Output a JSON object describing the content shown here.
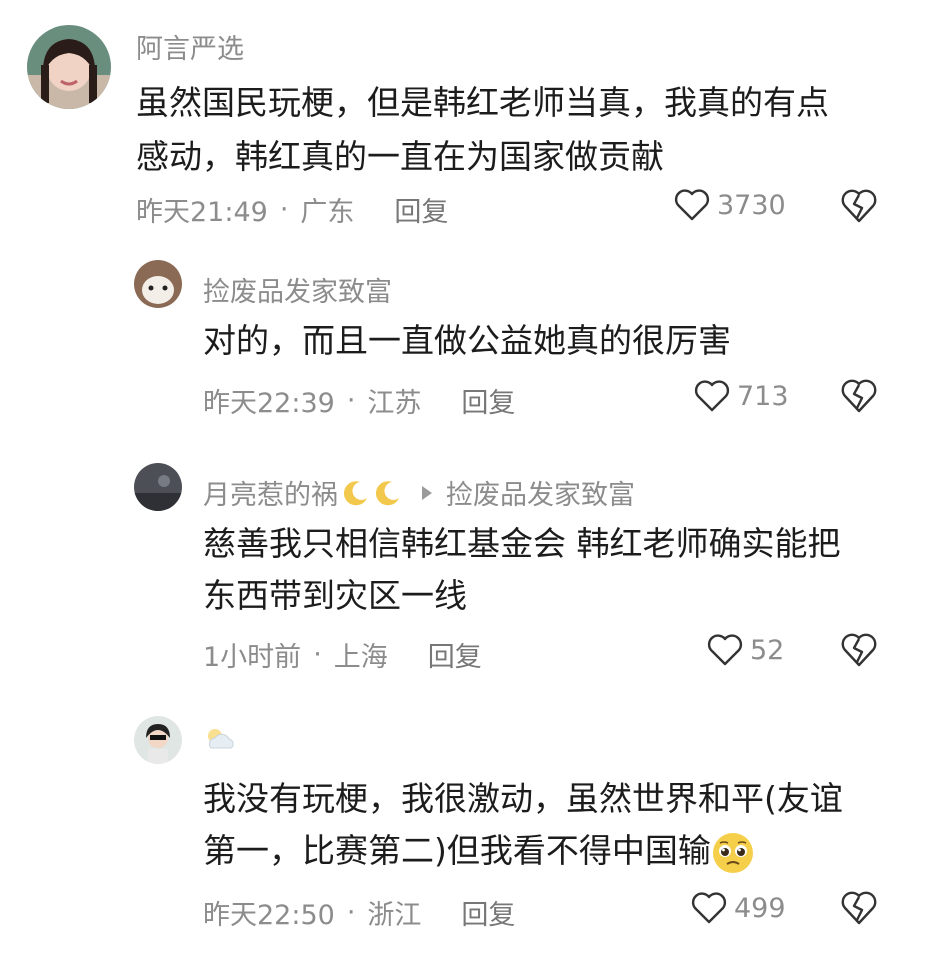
{
  "comments": [
    {
      "username": "阿言严选",
      "lines": [
        "虽然国民玩梗，但是韩红老师当真，我真的有点",
        "感动，韩红真的一直在为国家做贡献"
      ],
      "time": "昨天21:49",
      "location": "广东",
      "reply_label": "回复",
      "likes": "3730"
    },
    {
      "username": "捡废品发家致富",
      "lines": [
        "对的，而且一直做公益她真的很厉害"
      ],
      "time": "昨天22:39",
      "location": "江苏",
      "reply_label": "回复",
      "likes": "713"
    },
    {
      "username": "月亮惹的祸",
      "reply_to": "捡废品发家致富",
      "lines": [
        "慈善我只相信韩红基金会 韩红老师确实能把",
        "东西带到灾区一线"
      ],
      "time": "1小时前",
      "location": "上海",
      "reply_label": "回复",
      "likes": "52"
    },
    {
      "username": "",
      "lines": [
        "我没有玩梗，我很激动，虽然世界和平(友谊",
        "第一，比赛第二)但我看不得中国输"
      ],
      "time": "昨天22:50",
      "location": "浙江",
      "reply_label": "回复",
      "likes": "499"
    }
  ],
  "icons": {
    "like": "heart-outline-icon",
    "dislike": "broken-heart-icon",
    "cloud": "sun-behind-cloud-icon",
    "moon": "crescent-moon-icon",
    "emoji": "pleading-face-icon",
    "reply_arrow": "play-triangle-icon"
  },
  "colors": {
    "meta_text": "#8c8c8c",
    "body_text": "#1c1c1c",
    "background": "#ffffff"
  }
}
